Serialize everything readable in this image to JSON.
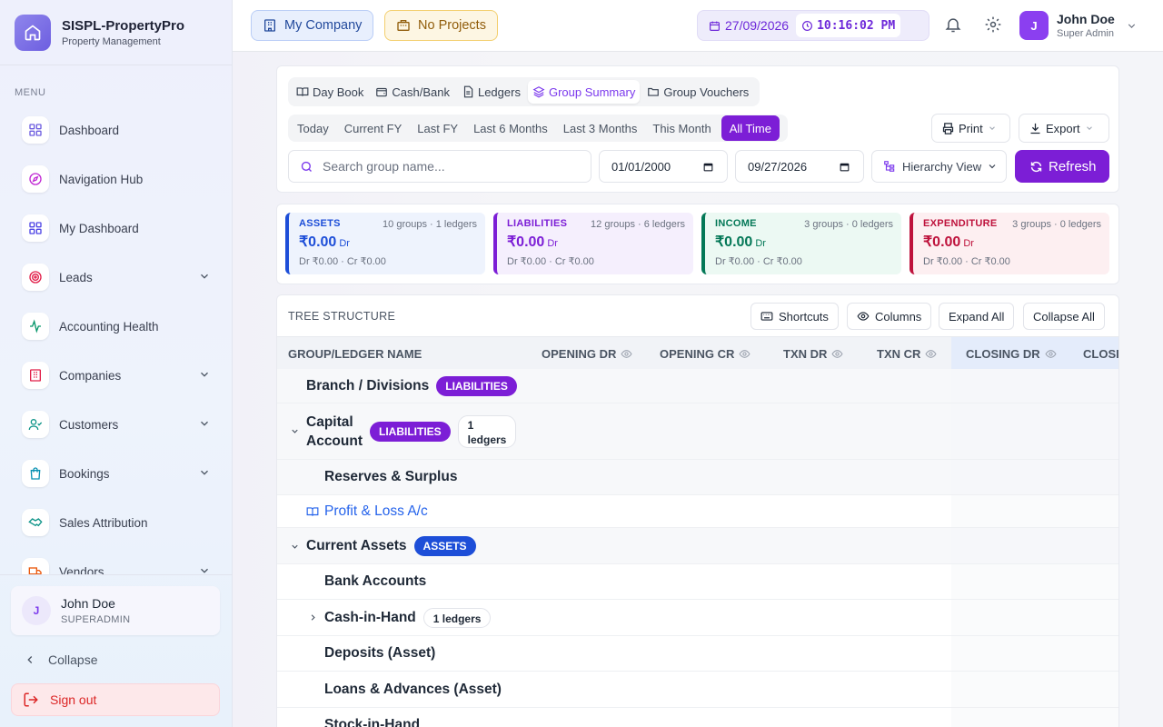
{
  "brand": {
    "name": "SISPL-PropertyPro",
    "subtitle": "Property Management"
  },
  "sidebar": {
    "menu_label": "MENU",
    "items": [
      {
        "label": "Dashboard",
        "icon": "grid-icon",
        "color": "#6d5ee0",
        "has_children": false
      },
      {
        "label": "Navigation Hub",
        "icon": "compass-icon",
        "color": "#c026d3",
        "has_children": false
      },
      {
        "label": "My Dashboard",
        "icon": "grid-icon",
        "color": "#4f46e5",
        "has_children": false
      },
      {
        "label": "Leads",
        "icon": "target-icon",
        "color": "#e11d48",
        "has_children": true
      },
      {
        "label": "Accounting Health",
        "icon": "activity-icon",
        "color": "#059669",
        "has_children": false
      },
      {
        "label": "Companies",
        "icon": "building-icon",
        "color": "#e11d48",
        "has_children": true
      },
      {
        "label": "Customers",
        "icon": "user-check-icon",
        "color": "#0d9488",
        "has_children": true
      },
      {
        "label": "Bookings",
        "icon": "shopping-bag-icon",
        "color": "#0891b2",
        "has_children": true
      },
      {
        "label": "Sales Attribution",
        "icon": "handshake-icon",
        "color": "#0d9488",
        "has_children": false
      },
      {
        "label": "Vendors",
        "icon": "truck-icon",
        "color": "#ea580c",
        "has_children": true
      }
    ],
    "user": {
      "initial": "J",
      "name": "John Doe",
      "role": "SUPERADMIN"
    },
    "collapse_label": "Collapse",
    "signout_label": "Sign out"
  },
  "topbar": {
    "company_label": "My Company",
    "projects_label": "No Projects",
    "date": "27/09/2026",
    "time": "10:16:02 PM",
    "user": {
      "initial": "J",
      "name": "John Doe",
      "role": "Super Admin"
    }
  },
  "tabs": [
    {
      "label": "Day Book",
      "icon": "book-open-icon",
      "active": false
    },
    {
      "label": "Cash/Bank",
      "icon": "wallet-icon",
      "active": false
    },
    {
      "label": "Ledgers",
      "icon": "file-text-icon",
      "active": false
    },
    {
      "label": "Group Summary",
      "icon": "layers-icon",
      "active": true
    },
    {
      "label": "Group Vouchers",
      "icon": "folder-open-icon",
      "active": false
    }
  ],
  "periods": [
    {
      "label": "Today",
      "active": false
    },
    {
      "label": "Current FY",
      "active": false
    },
    {
      "label": "Last FY",
      "active": false
    },
    {
      "label": "Last 6 Months",
      "active": false
    },
    {
      "label": "Last 3 Months",
      "active": false
    },
    {
      "label": "This Month",
      "active": false
    },
    {
      "label": "All Time",
      "active": true
    }
  ],
  "actions": {
    "print_label": "Print",
    "export_label": "Export"
  },
  "filters": {
    "search_placeholder": "Search group name...",
    "from_date": "01/01/2000",
    "to_date": "09/27/2026",
    "view_label": "Hierarchy View",
    "refresh_label": "Refresh"
  },
  "summary": [
    {
      "title": "ASSETS",
      "meta": "10 groups · 1 ledgers",
      "amount": "₹0.00",
      "side": "Dr",
      "sub": "Dr ₹0.00 · Cr ₹0.00",
      "color": "#1d4ed8",
      "bg": "#eef3fd"
    },
    {
      "title": "LIABILITIES",
      "meta": "12 groups · 6 ledgers",
      "amount": "₹0.00",
      "side": "Dr",
      "sub": "Dr ₹0.00 · Cr ₹0.00",
      "color": "#7c1ed6",
      "bg": "#f5effd"
    },
    {
      "title": "INCOME",
      "meta": "3 groups · 0 ledgers",
      "amount": "₹0.00",
      "side": "Dr",
      "sub": "Dr ₹0.00 · Cr ₹0.00",
      "color": "#047857",
      "bg": "#ecf9f3"
    },
    {
      "title": "EXPENDITURE",
      "meta": "3 groups · 0 ledgers",
      "amount": "₹0.00",
      "side": "Dr",
      "sub": "Dr ₹0.00 · Cr ₹0.00",
      "color": "#be123c",
      "bg": "#fdeff1"
    }
  ],
  "tree": {
    "title": "TREE STRUCTURE",
    "shortcuts_label": "Shortcuts",
    "columns_label": "Columns",
    "expand_label": "Expand All",
    "collapse_label": "Collapse All",
    "columns": [
      "GROUP/LEDGER NAME",
      "OPENING DR",
      "OPENING CR",
      "TXN DR",
      "TXN CR",
      "CLOSING DR",
      "CLOSI"
    ],
    "rows": [
      {
        "name": "Branch / Divisions",
        "badge": "LIABILITIES",
        "ledgers": ""
      },
      {
        "name_line1": "Capital",
        "name_line2": "Account",
        "badge": "LIABILITIES",
        "ledgers_count": "1",
        "ledgers_word": "ledgers"
      },
      {
        "name": "Reserves & Surplus"
      },
      {
        "name": "Profit & Loss A/c"
      },
      {
        "name": "Current Assets",
        "badge": "ASSETS"
      },
      {
        "name": "Bank Accounts"
      },
      {
        "name": "Cash-in-Hand",
        "ledgers": "1 ledgers"
      },
      {
        "name": "Deposits (Asset)"
      },
      {
        "name": "Loans & Advances (Asset)"
      },
      {
        "name": "Stock-in-Hand"
      }
    ]
  }
}
